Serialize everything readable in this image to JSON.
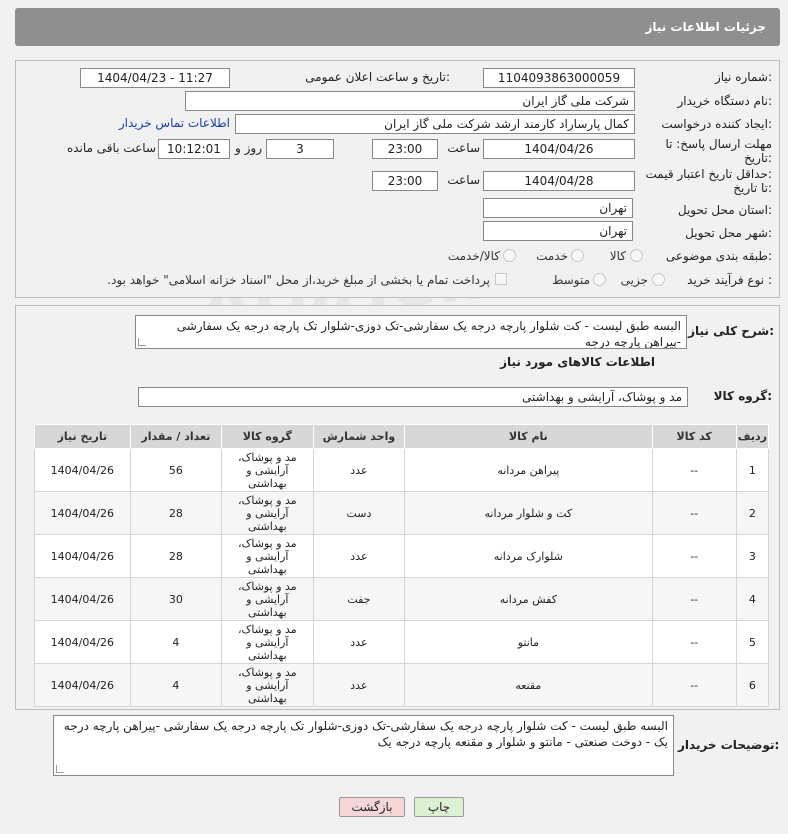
{
  "header": {
    "title": "جزئیات اطلاعات نیاز"
  },
  "form": {
    "need_number_label": "شماره نیاز:",
    "need_number": "1104093863000059",
    "announce_label": "تاریخ و ساعت اعلان عمومی:",
    "announce_value": "1404/04/23 - 11:27",
    "buyer_org_label": "نام دستگاه خریدار:",
    "buyer_org": "شرکت ملی گاز ایران",
    "creator_label": "ایجاد کننده درخواست:",
    "creator": "کمال پارساراد کارمند ارشد شرکت ملی گاز ایران",
    "contact_link": "اطلاعات تماس خریدار",
    "deadline_label_1": "مهلت ارسال پاسخ: تا",
    "deadline_label_2": "تاریخ:",
    "deadline_date": "1404/04/26",
    "time_label": "ساعت",
    "deadline_time": "23:00",
    "days_value": "3",
    "days_label": "روز و",
    "remaining_time": "10:12:01",
    "remaining_label": "ساعت باقی مانده",
    "validity_label_1": "حداقل تاریخ اعتبار قیمت:",
    "validity_label_2": "تا تاریخ:",
    "validity_date": "1404/04/28",
    "validity_time": "23:00",
    "province_label": "استان محل تحویل:",
    "province": "تهران",
    "city_label": "شهر محل تحویل:",
    "city": "تهران",
    "category_label": "طبقه بندی موضوعی:",
    "category_options": [
      "کالا",
      "خدمت",
      "کالا/خدمت"
    ],
    "purchase_type_label": "نوع فرآیند خرید :",
    "purchase_options": [
      "جزیی",
      "متوسط"
    ],
    "payment_note": "پرداخت تمام یا بخشی از مبلغ خرید،از محل \"اسناد خزانه اسلامی\" خواهد بود."
  },
  "description": {
    "label": "شرح کلی نیاز:",
    "text": "البسه طبق لیست - کت شلوار پارچه درجه یک سفارشی-تک دوزی-شلوار تک پارچه درجه یک سفارشی -پیراهن پارچه درجه"
  },
  "goods": {
    "section_title": "اطلاعات کالاهای مورد نیاز",
    "group_label": "گروه کالا:",
    "group_value": "مد و پوشاک، آرایشی و بهداشتی",
    "columns": [
      "ردیف",
      "کد کالا",
      "نام کالا",
      "واحد شمارش",
      "گروه کالا",
      "تعداد / مقدار",
      "تاریخ نیاز"
    ],
    "rows": [
      {
        "idx": "1",
        "code": "--",
        "name": "پیراهن مردانه",
        "unit": "عدد",
        "group": "مد و پوشاک، آرایشی و بهداشتی",
        "qty": "56",
        "date": "1404/04/26"
      },
      {
        "idx": "2",
        "code": "--",
        "name": "کت و شلوار مردانه",
        "unit": "دست",
        "group": "مد و پوشاک، آرایشی و بهداشتی",
        "qty": "28",
        "date": "1404/04/26"
      },
      {
        "idx": "3",
        "code": "--",
        "name": "شلوارک مردانه",
        "unit": "عدد",
        "group": "مد و پوشاک، آرایشی و بهداشتی",
        "qty": "28",
        "date": "1404/04/26"
      },
      {
        "idx": "4",
        "code": "--",
        "name": "کفش مردانه",
        "unit": "جفت",
        "group": "مد و پوشاک، آرایشی و بهداشتی",
        "qty": "30",
        "date": "1404/04/26"
      },
      {
        "idx": "5",
        "code": "--",
        "name": "مانتو",
        "unit": "عدد",
        "group": "مد و پوشاک، آرایشی و بهداشتی",
        "qty": "4",
        "date": "1404/04/26"
      },
      {
        "idx": "6",
        "code": "--",
        "name": "مقنعه",
        "unit": "عدد",
        "group": "مد و پوشاک، آرایشی و بهداشتی",
        "qty": "4",
        "date": "1404/04/26"
      }
    ]
  },
  "buyer_notes": {
    "label": "توضیحات خریدار:",
    "text": "البسه طبق لیست - کت شلوار پارچه درجه یک سفارشی-تک دوزی-شلوار تک پارچه درجه یک سفارشی -پیراهن پارچه درجه یک - دوخت صنعتی - مانتو و شلوار و مقنعه پارچه درجه یک"
  },
  "buttons": {
    "print": "چاپ",
    "back": "بازگشت"
  },
  "watermark": "AriaTender.neT",
  "colors": {
    "header_bg": "#8f8f8f",
    "back_button": "#f5d7d7",
    "print_button": "#dcf1d4",
    "link": "#1a3fa6"
  }
}
